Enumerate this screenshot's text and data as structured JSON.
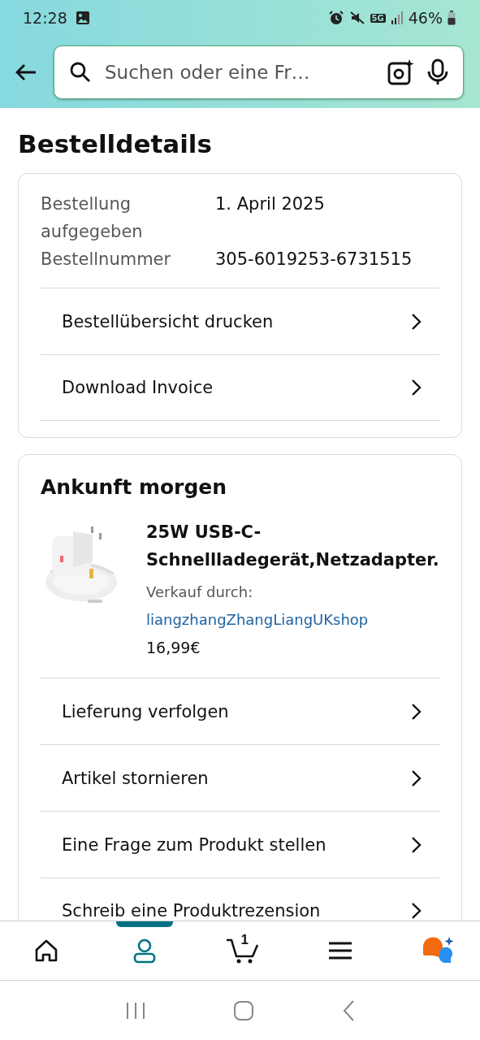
{
  "status_bar": {
    "time": "12:28",
    "network": "5G",
    "battery": "46%"
  },
  "search": {
    "placeholder": "Suchen oder eine Fr…"
  },
  "title": "Bestelldetails",
  "order_card": {
    "info": [
      {
        "label": "Bestellung aufgegeben",
        "value": "1. April 2025"
      },
      {
        "label": "Bestellnummer",
        "value": "305-6019253-6731515"
      }
    ],
    "actions": [
      "Bestellübersicht drucken",
      "Download Invoice"
    ]
  },
  "shipment_card": {
    "heading": "Ankunft morgen",
    "product": {
      "title": "25W USB-C-Schnellladegerät,Netzadapter.",
      "sold_by_label": "Verkauf durch:",
      "seller": "liangzhangZhangLiangUKshop",
      "price": "16,99€"
    },
    "actions": [
      "Lieferung verfolgen",
      "Artikel stornieren",
      "Eine Frage zum Produkt stellen",
      "Schreib eine Produktrezension"
    ]
  },
  "bottom_nav": [
    {
      "kind": "home",
      "selected": false
    },
    {
      "kind": "account",
      "selected": true
    },
    {
      "kind": "cart",
      "selected": false,
      "badge": "1"
    },
    {
      "kind": "menu",
      "selected": false
    },
    {
      "kind": "assistant",
      "selected": false
    }
  ]
}
